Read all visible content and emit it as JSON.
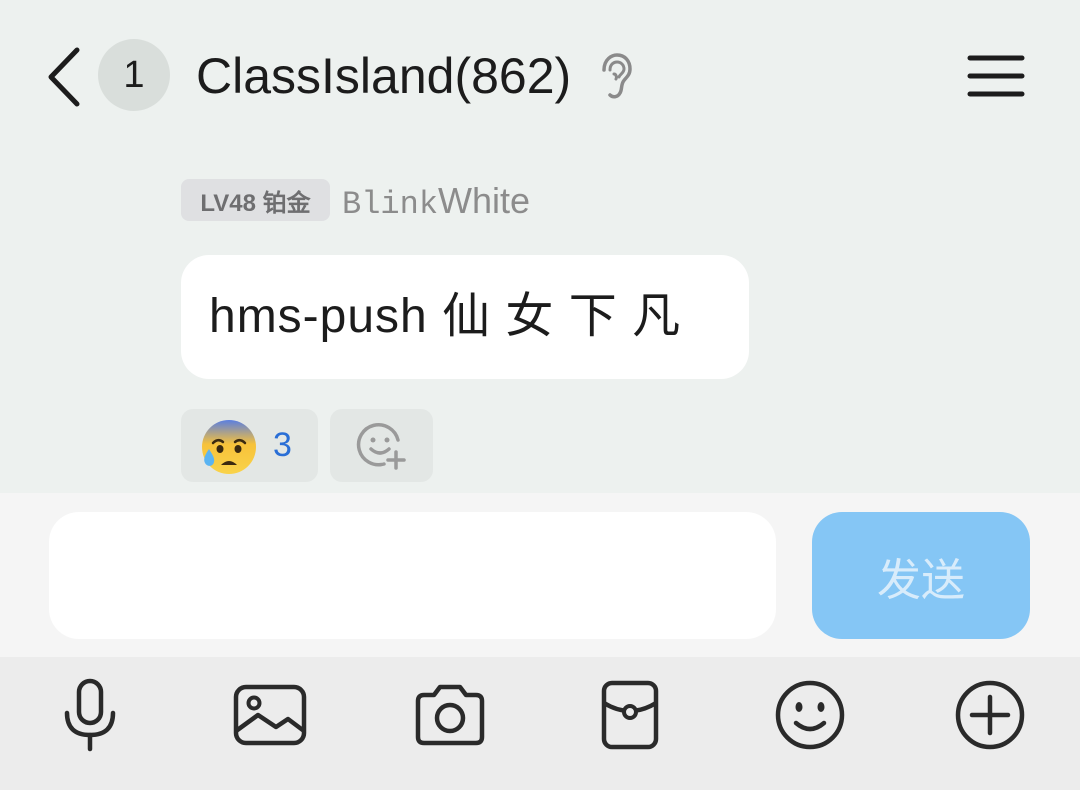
{
  "header": {
    "unread_count": "1",
    "title": "ClassIsland(862)",
    "icons": [
      "back-arrow-icon",
      "ear-icon",
      "menu-icon"
    ]
  },
  "message": {
    "badge": "LV48 铂金",
    "sender_prefix": "Blink",
    "sender_suffix": "White",
    "text": "hms-push 仙 女 下 凡",
    "reaction": {
      "emoji_name": "anxious-face-with-sweat-icon",
      "count": "3"
    }
  },
  "composer": {
    "input_value": "",
    "send_label": "发送",
    "send_color": "#85c6f5"
  },
  "toolbar": {
    "items": [
      "microphone-icon",
      "image-icon",
      "camera-icon",
      "red-packet-icon",
      "emoji-icon",
      "plus-icon"
    ]
  },
  "colors": {
    "background": "#edf1ef",
    "count_blue": "#2a6fd6"
  }
}
